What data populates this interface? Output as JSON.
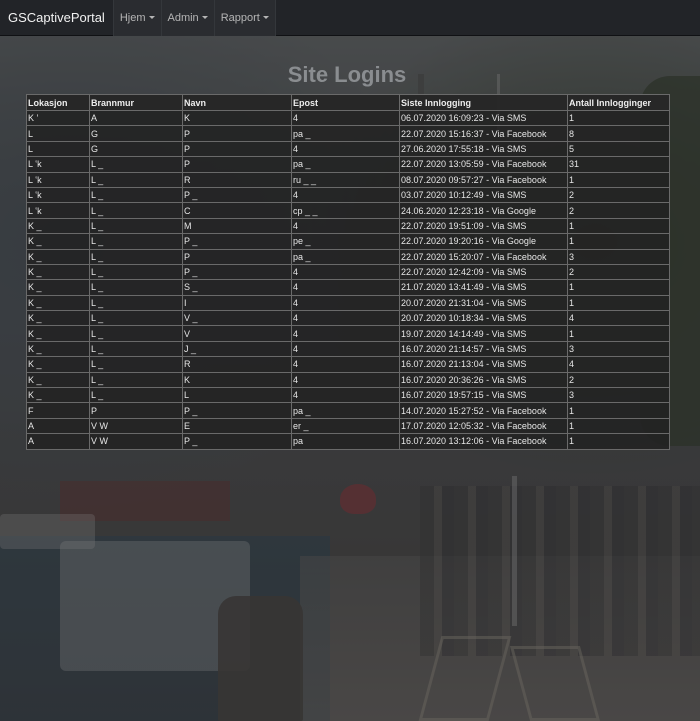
{
  "navbar": {
    "brand": "GSCaptivePortal",
    "items": [
      {
        "label": "Hjem"
      },
      {
        "label": "Admin"
      },
      {
        "label": "Rapport"
      }
    ]
  },
  "page": {
    "title": "Site Logins"
  },
  "table": {
    "headers": [
      "Lokasjon",
      "Brannmur",
      "Navn",
      "Epost",
      "Siste Innlogging",
      "Antall Innlogginger"
    ],
    "rows": [
      [
        "K  ‛",
        "A",
        "K",
        "4",
        "06.07.2020 16:09:23 - Via SMS",
        "1"
      ],
      [
        "L",
        "G",
        "P",
        "pa  _",
        "22.07.2020 15:16:37 - Via Facebook",
        "8"
      ],
      [
        "L",
        "G",
        "P",
        "4",
        "27.06.2020 17:55:18 - Via SMS",
        "5"
      ],
      [
        "L  ‛k",
        "L  _",
        "P",
        "pa  _",
        "22.07.2020 13:05:59 - Via Facebook",
        "31"
      ],
      [
        "L  ‛k",
        "L  _",
        "R",
        "ru  _  _",
        "08.07.2020 09:57:27 - Via Facebook",
        "1"
      ],
      [
        "L  ‛k",
        "L  _",
        "P  _",
        "4",
        "03.07.2020 10:12:49 - Via SMS",
        "2"
      ],
      [
        "L  ‛k",
        "L  _",
        "C",
        "cp  _  _",
        "24.06.2020 12:23:18 - Via Google",
        "2"
      ],
      [
        "K  _",
        "L  _",
        "M",
        "4",
        "22.07.2020 19:51:09 - Via SMS",
        "1"
      ],
      [
        "K  _",
        "L  _",
        "P  _",
        "pe  _",
        "22.07.2020 19:20:16 - Via Google",
        "1"
      ],
      [
        "K  _",
        "L  _",
        "P",
        "pa  _",
        "22.07.2020 15:20:07 - Via Facebook",
        "3"
      ],
      [
        "K  _",
        "L  _",
        "P  _",
        "4",
        "22.07.2020 12:42:09 - Via SMS",
        "2"
      ],
      [
        "K  _",
        "L  _",
        "S  _",
        "4",
        "21.07.2020 13:41:49 - Via SMS",
        "1"
      ],
      [
        "K  _",
        "L  _",
        "I",
        "4",
        "20.07.2020 21:31:04 - Via SMS",
        "1"
      ],
      [
        "K  _",
        "L  _",
        "V  _",
        "4",
        "20.07.2020 10:18:34 - Via SMS",
        "4"
      ],
      [
        "K  _",
        "L  _",
        "V",
        "4",
        "19.07.2020 14:14:49 - Via SMS",
        "1"
      ],
      [
        "K  _",
        "L  _",
        "J  _",
        "4",
        "16.07.2020 21:14:57 - Via SMS",
        "3"
      ],
      [
        "K  _",
        "L  _",
        "R",
        "4",
        "16.07.2020 21:13:04 - Via SMS",
        "4"
      ],
      [
        "K  _",
        "L  _",
        "K",
        "4",
        "16.07.2020 20:36:26 - Via SMS",
        "2"
      ],
      [
        "K  _",
        "L  _",
        "L",
        "4",
        "16.07.2020 19:57:15 - Via SMS",
        "3"
      ],
      [
        "F",
        "P",
        "P  _",
        "pa  _",
        "14.07.2020 15:27:52 - Via Facebook",
        "1"
      ],
      [
        "A",
        "V        W",
        "E",
        "er  _",
        "17.07.2020 12:05:32 - Via Facebook",
        "1"
      ],
      [
        "A",
        "V        W",
        "P  _",
        "pa",
        "16.07.2020 13:12:06 - Via Facebook",
        "1"
      ]
    ]
  }
}
